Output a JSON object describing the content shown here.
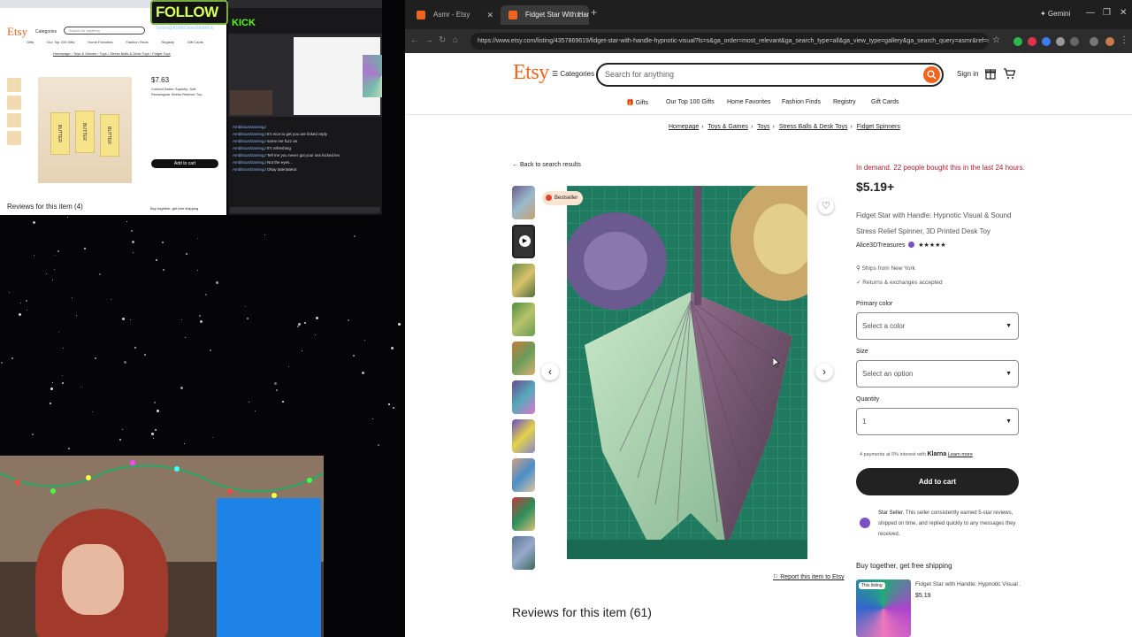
{
  "overlay": {
    "follow": "FOLLOW",
    "follow_sub": "Twitch@ASMRStarsWithRick",
    "kick": "KICK",
    "mini_etsy": {
      "logo": "Etsy",
      "categories": "Categories",
      "search": "Search for anything",
      "nav": [
        "Gifts",
        "Our Top 100 Gifts",
        "Home Favorites",
        "Fashion Finds",
        "Registry",
        "Gift Cards"
      ],
      "crumbs": "Homepage › Toys & Games › Toys › Stress Balls & Desk Toys › Fidget Toys",
      "price": "$7.63",
      "desc": "Colored Butter Squishy: Soft Rectangular Stress Reliever Toy",
      "add_to_cart": "Add to cart",
      "reviews": "Reviews for this item (4)",
      "buy_together": "Buy together, get free shipping",
      "bar_label": "BUTTER"
    },
    "chat": [
      {
        "user": "AmbitiousGamingJ",
        "msg": ""
      },
      {
        "user": "AmbitiousGamingJ",
        "msg": "It's nice to get you are linked reply"
      },
      {
        "user": "AmbitiousGamingJ",
        "msg": "same me fuzz as"
      },
      {
        "user": "AmbitiousGamingJ",
        "msg": "It's refreshing"
      },
      {
        "user": "AmbitiousGamingJ",
        "msg": "Tell me you never got your ass kicked lex"
      },
      {
        "user": "AmbitiousGamingJ",
        "msg": "Not the eyes..."
      },
      {
        "user": "AmbitiousGamingJ",
        "msg": "Okay tatertatetot"
      },
      {
        "user": "",
        "msg": ""
      },
      {
        "user": "",
        "msg": ""
      },
      {
        "user": "",
        "msg": ""
      }
    ]
  },
  "browser": {
    "tabs": [
      {
        "label": "Asmr - Etsy",
        "active": false
      },
      {
        "label": "Fidget Star With Handle: Hypn",
        "active": true
      }
    ],
    "gemini": "Gemini",
    "url": "https://www.etsy.com/listing/4357869619/fidget-star-with-handle-hypnotic-visual?ls=s&ga_order=most_relevant&ga_search_type=all&ga_view_type=gallery&ga_search_query=asmr&ref=sr_gallery-2-2&sr_prefetch=..."
  },
  "header": {
    "logo": "Etsy",
    "categories": "Categories",
    "search_placeholder": "Search for anything",
    "signin": "Sign in"
  },
  "subnav": [
    "Gifts",
    "Our Top 100 Gifts",
    "Home Favorites",
    "Fashion Finds",
    "Registry",
    "Gift Cards"
  ],
  "breadcrumbs": [
    "Homepage",
    "Toys & Games",
    "Toys",
    "Stress Balls & Desk Toys",
    "Fidget Spinners"
  ],
  "back": "Back to search results",
  "bestseller": "Bestseller",
  "report": "Report this item to Etsy",
  "reviews_heading": "Reviews for this item (61)",
  "product": {
    "demand": "In demand. 22 people bought this in the last 24 hours.",
    "price": "$5.19+",
    "title": "Fidget Star with Handle: Hypnotic Visual & Sound Stress Relief Spinner, 3D Printed Desk Toy",
    "shop": "Alice3DTreasures",
    "rating": "★★★★★",
    "ships_from": "Ships from New York",
    "returns": "Returns & exchanges accepted",
    "primary_color_label": "Primary color",
    "primary_color_value": "Select a color",
    "size_label": "Size",
    "size_value": "Select an option",
    "quantity_label": "Quantity",
    "quantity_value": "1",
    "klarna_prefix": "4 payments at 0% interest with",
    "klarna_brand": "Klarna",
    "klarna_link": "Learn more",
    "add_to_cart": "Add to cart",
    "star_seller_title": "Star Seller.",
    "star_seller_text": "This seller consistently earned 5-star reviews, shipped on time, and replied quickly to any messages they received.",
    "bundle_heading": "Buy together, get free shipping",
    "bundle_tag": "This listing",
    "bundle_title": "Fidget Star with Handle: Hypnotic Visual ...",
    "bundle_price": "$5.19"
  },
  "colors": {
    "accent": "#f1641e",
    "demand": "#a61a2e",
    "star_seller": "#7d4fc4"
  }
}
